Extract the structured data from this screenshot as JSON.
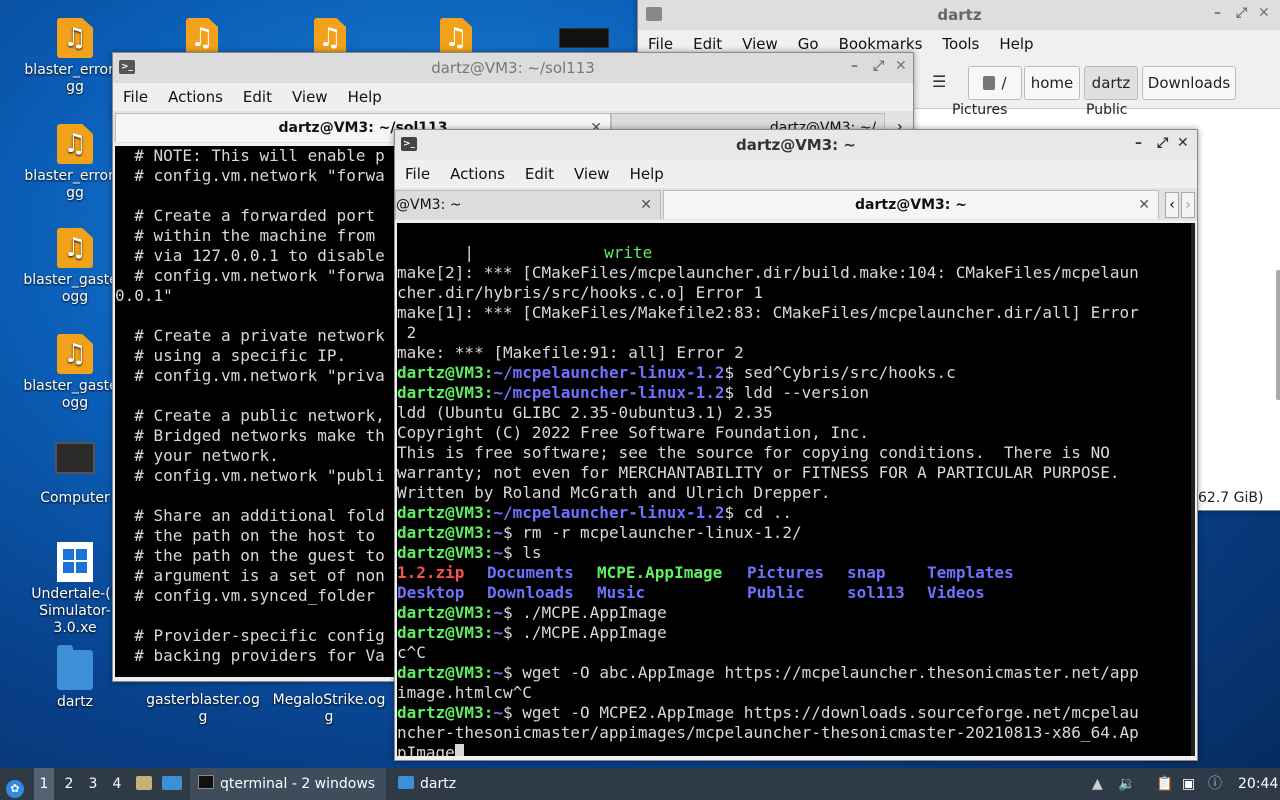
{
  "desktop": {
    "icons": [
      {
        "label": "blaster_error.ogg"
      },
      {
        "label": "blaster_error.ogg"
      },
      {
        "label": "blaster_gaster.ogg"
      },
      {
        "label": "blaster_gaster.ogg"
      },
      {
        "label": "Computer"
      },
      {
        "label": "Undertale-(F Simulator-3.0.xe"
      },
      {
        "label": "dartz"
      },
      {
        "label": "gasterblaster.ogg"
      },
      {
        "label": "MegaloStrike.ogg"
      }
    ]
  },
  "filemanager": {
    "title": "dartz",
    "menu": [
      "File",
      "Edit",
      "View",
      "Go",
      "Bookmarks",
      "Tools",
      "Help"
    ],
    "path": [
      "/",
      "home",
      "dartz",
      "Downloads"
    ],
    "partial_items": [
      "Pictures",
      "Public"
    ],
    "free_space": "62.7 GiB)"
  },
  "term1": {
    "title": "dartz@VM3: ~/sol113",
    "menu": [
      "File",
      "Actions",
      "Edit",
      "View",
      "Help"
    ],
    "tabs": [
      "dartz@VM3: ~/sol113",
      "dartz@VM3: ~/"
    ],
    "lines": [
      "  # NOTE: This will enable p",
      "  # config.vm.network \"forwa",
      "",
      "  # Create a forwarded port ",
      "  # within the machine from ",
      "  # via 127.0.0.1 to disable",
      "  # config.vm.network \"forwa",
      "0.0.1\"",
      "",
      "  # Create a private network",
      "  # using a specific IP.",
      "  # config.vm.network \"priva",
      "",
      "  # Create a public network,",
      "  # Bridged networks make th",
      "  # your network.",
      "  # config.vm.network \"publi",
      "",
      "  # Share an additional fold",
      "  # the path on the host to ",
      "  # the path on the guest to",
      "  # argument is a set of non",
      "  # config.vm.synced_folder ",
      "",
      "  # Provider-specific config",
      "  # backing providers for Va"
    ]
  },
  "term2": {
    "title": "dartz@VM3: ~",
    "menu": [
      "File",
      "Actions",
      "Edit",
      "View",
      "Help"
    ],
    "tabs": [
      "@VM3: ~",
      "dartz@VM3: ~"
    ],
    "prompt_user": "dartz@VM3",
    "lines": {
      "l0a": "       |",
      "l0b": "write",
      "l1": "make[2]: *** [CMakeFiles/mcpelauncher.dir/build.make:104: CMakeFiles/mcpelaun",
      "l2": "cher.dir/hybris/src/hooks.c.o] Error 1",
      "l3": "make[1]: *** [CMakeFiles/Makefile2:83: CMakeFiles/mcpelauncher.dir/all] Error",
      "l4": " 2",
      "l5": "make: *** [Makefile:91: all] Error 2",
      "p6": "~/mcpelauncher-linux-1.2",
      "c6": "$ sed^Cybris/src/hooks.c",
      "p7": "~/mcpelauncher-linux-1.2",
      "c7": "$ ldd --version",
      "l8": "ldd (Ubuntu GLIBC 2.35-0ubuntu3.1) 2.35",
      "l9": "Copyright (C) 2022 Free Software Foundation, Inc.",
      "l10": "This is free software; see the source for copying conditions.  There is NO",
      "l11": "warranty; not even for MERCHANTABILITY or FITNESS FOR A PARTICULAR PURPOSE.",
      "l12": "Written by Roland McGrath and Ulrich Drepper.",
      "p13": "~/mcpelauncher-linux-1.2",
      "c13": "$ cd ..",
      "p14": "~",
      "c14": "$ rm -r mcpelauncher-linux-1.2/",
      "p15": "~",
      "c15": "$ ls",
      "ls1": [
        "1.2.zip",
        "Documents",
        "MCPE.AppImage",
        "Pictures",
        "snap",
        "Templates"
      ],
      "ls2": [
        "Desktop",
        "Downloads",
        "Music",
        "Public",
        "sol113",
        "Videos"
      ],
      "p18": "~",
      "c18": "$ ./MCPE.AppImage",
      "p19": "~",
      "c19": "$ ./MCPE.AppImage",
      "l20": "c^C",
      "p21": "~",
      "c21": "$ wget -O abc.AppImage https://mcpelauncher.thesonicmaster.net/app",
      "l22": "image.htmlcw^C",
      "p23": "~",
      "c23": "$ wget -O MCPE2.AppImage https://downloads.sourceforge.net/mcpelau",
      "l24": "ncher-thesonicmaster/appimages/mcpelauncher-thesonicmaster-20210813-x86_64.Ap",
      "l25": "pImage"
    }
  },
  "taskbar": {
    "workspaces": [
      "1",
      "2",
      "3",
      "4"
    ],
    "tasks": [
      "qterminal - 2 windows",
      "dartz"
    ],
    "clock": "20:44"
  },
  "colors": {
    "prompt": "#5ef05e",
    "path": "#7070ff",
    "zip": "#ff5050"
  }
}
